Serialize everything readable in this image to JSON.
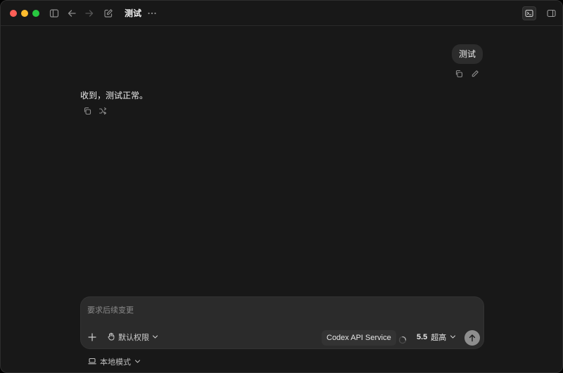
{
  "titlebar": {
    "title": "测试",
    "icons": [
      "sidebar-toggle-icon",
      "back-arrow-icon",
      "forward-arrow-icon",
      "compose-icon",
      "more-icon",
      "terminal-icon",
      "right-panel-icon"
    ]
  },
  "conversation": {
    "user_message": "测试",
    "assistant_message": "收到，测试正常。"
  },
  "composer": {
    "placeholder": "要求后续变更",
    "permission_label": "默认权限",
    "service_label": "Codex API Service",
    "model_version": "5.5",
    "model_effort": "超高"
  },
  "footer": {
    "mode_label": "本地模式"
  },
  "colors": {
    "window_bg": "#181818",
    "bubble_bg": "#2c2c2c",
    "composer_bg": "#2b2b2b",
    "send_button": "#8e8e8e",
    "close": "#ff5f57",
    "minimize": "#febc2e",
    "maximize": "#28c840"
  }
}
